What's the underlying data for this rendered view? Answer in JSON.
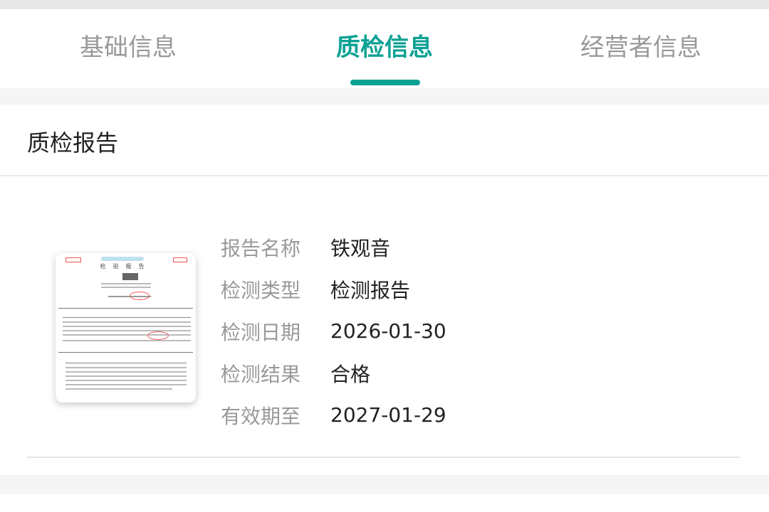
{
  "tabs": [
    {
      "label": "基础信息"
    },
    {
      "label": "质检信息"
    },
    {
      "label": "经营者信息"
    }
  ],
  "active_tab": 1,
  "accent_color": "#0aa193",
  "section": {
    "title": "质检报告"
  },
  "report": {
    "thumbnail_text": "检验报告",
    "fields": [
      {
        "label": "报告名称",
        "value": "铁观音"
      },
      {
        "label": "检测类型",
        "value": "检测报告"
      },
      {
        "label": "检测日期",
        "value": "2026-01-30"
      },
      {
        "label": "检测结果",
        "value": "合格"
      },
      {
        "label": "有效期至",
        "value": "2027-01-29"
      }
    ]
  }
}
